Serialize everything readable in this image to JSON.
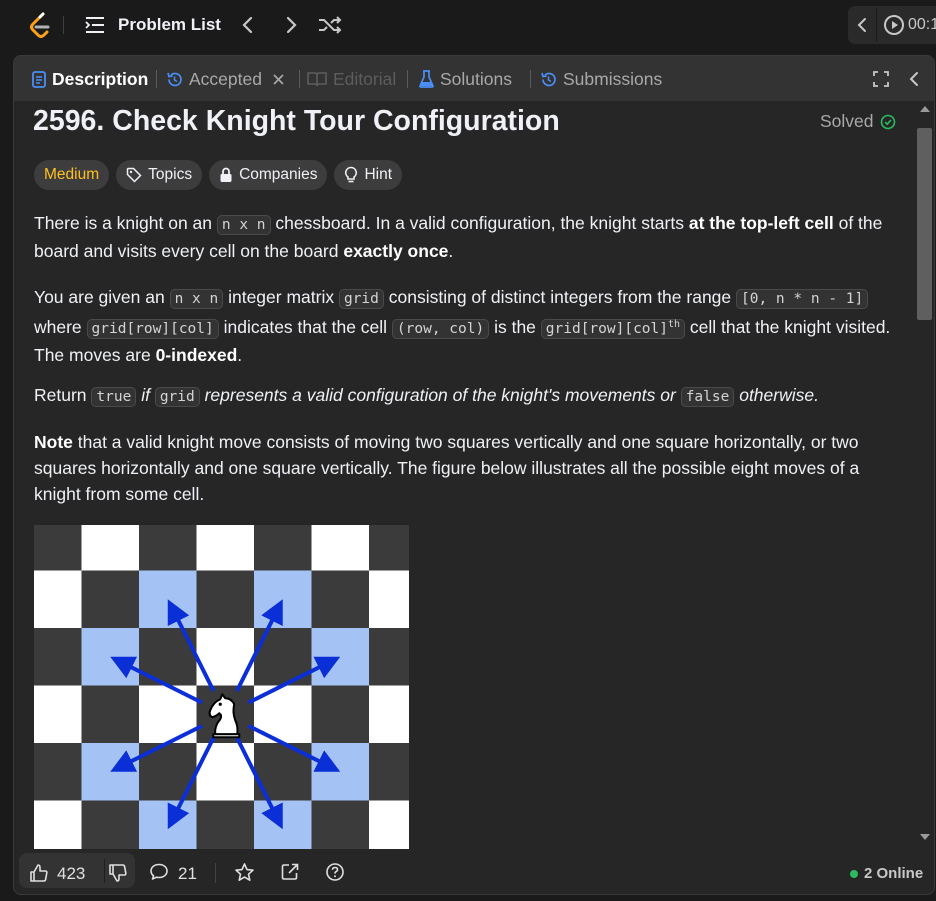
{
  "topbar": {
    "problem_list_label": "Problem List",
    "timer_text": "00:1"
  },
  "tabs": {
    "description": "Description",
    "accepted": "Accepted",
    "editorial": "Editorial",
    "solutions": "Solutions",
    "submissions": "Submissions"
  },
  "problem": {
    "title": "2596. Check Knight Tour Configuration",
    "solved_label": "Solved",
    "difficulty": "Medium",
    "pills": {
      "topics": "Topics",
      "companies": "Companies",
      "hint": "Hint"
    },
    "p1": {
      "a": "There is a knight on an ",
      "code1": "n x n",
      "b": " chessboard. In a valid configuration, the knight starts ",
      "bold1": "at the top-left cell",
      "c": " of the board and visits every cell on the board ",
      "bold2": "exactly once",
      "d": "."
    },
    "p2": {
      "a": "You are given an ",
      "code1": "n x n",
      "b": " integer matrix ",
      "code2": "grid",
      "c": " consisting of distinct integers from the range ",
      "code3": "[0, n * n - 1]",
      "d": " where ",
      "code4": "grid[row][col]",
      "e": " indicates that the cell ",
      "code5": "(row, col)",
      "f": " is the ",
      "code6": "grid[row][col]",
      "sup": "th",
      "g": " cell that the knight visited. The moves are ",
      "bold1": "0-indexed",
      "h": "."
    },
    "p3": {
      "a": "Return ",
      "code1": "true",
      "b": " ",
      "i1": "if ",
      "code2": "grid",
      "i2": " represents a valid configuration of the knight's movements or ",
      "code3": "false",
      "i3": " otherwise."
    },
    "p4": {
      "bold1": "Note",
      "a": " that a valid knight move consists of moving two squares vertically and one square horizontally, or two squares horizontally and one square vertically. The figure below illustrates all the possible eight moves of a knight from some cell."
    }
  },
  "bottom": {
    "likes": "423",
    "comments": "21",
    "online": "2 Online"
  },
  "colors": {
    "accent_green": "#2cbb5d",
    "medium": "#ffc01e",
    "board_dark": "#3b3b3b",
    "board_light": "#ffffff",
    "board_highlight": "#a4c2f4",
    "arrow": "#0b2fd6"
  }
}
